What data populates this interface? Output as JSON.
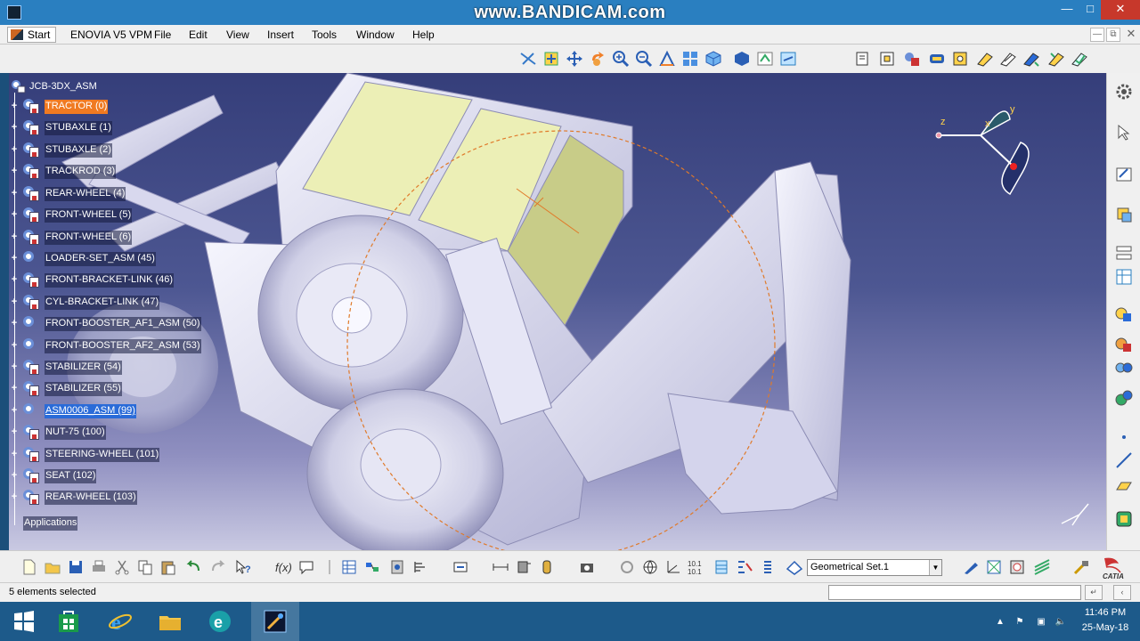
{
  "watermark": "www.BANDICAM.com",
  "menubar": {
    "start": "Start",
    "items": [
      "ENOVIA V5 VPM",
      "File",
      "Edit",
      "View",
      "Insert",
      "Tools",
      "Window",
      "Help"
    ]
  },
  "tree": {
    "root": "JCB-3DX_ASM",
    "nodes": [
      "TRACTOR (0)",
      "STUBAXLE (1)",
      "STUBAXLE (2)",
      "TRACKROD (3)",
      "REAR-WHEEL (4)",
      "FRONT-WHEEL (5)",
      "FRONT-WHEEL (6)",
      "LOADER-SET_ASM (45)",
      "FRONT-BRACKET-LINK (46)",
      "CYL-BRACKET-LINK (47)",
      "FRONT-BOOSTER_AF1_ASM (50)",
      "FRONT-BOOSTER_AF2_ASM (53)",
      "STABILIZER (54)",
      "STABILIZER (55)",
      "ASM0006_ASM (99)",
      "NUT-75 (100)",
      "STEERING-WHEEL (101)",
      "SEAT (102)",
      "REAR-WHEEL (103)"
    ],
    "applications": "Applications"
  },
  "compass": {
    "x_label": "x",
    "y_label": "y",
    "z_label": "z"
  },
  "geometrical_set": "Geometrical Set.1",
  "status": {
    "message": "5 elements selected"
  },
  "taskbar": {
    "time": "11:46 PM",
    "date": "25-May-18"
  },
  "colors": {
    "selection_orange": "#f07a21",
    "selection_blue": "#2a6bd8",
    "title_bar": "#2a7fc0",
    "taskbar": "#1d5a8a"
  }
}
